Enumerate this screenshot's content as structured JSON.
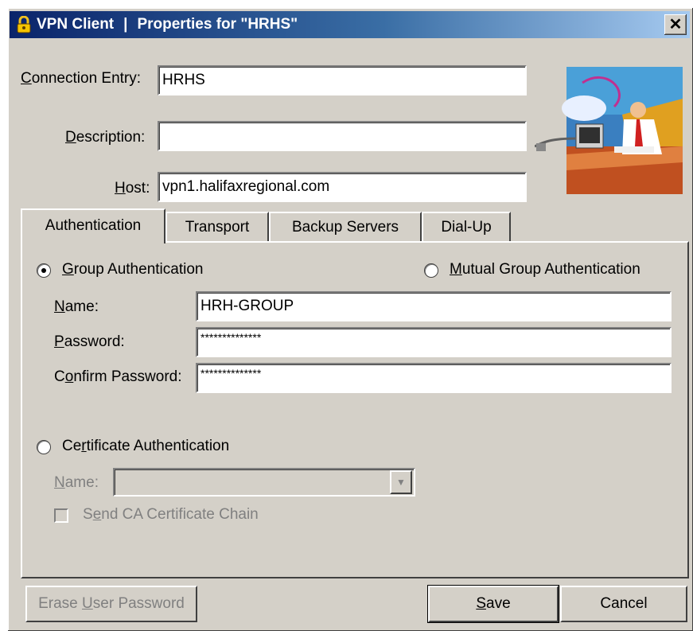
{
  "window": {
    "title_app": "VPN Client",
    "title_separator": "|",
    "title_text": "Properties for \"HRHS\"",
    "close_glyph": "✕"
  },
  "header": {
    "connection_entry": {
      "label_ul": "C",
      "label_rest": "onnection Entry:",
      "value": "HRHS"
    },
    "description": {
      "label_ul": "D",
      "label_rest": "escription:",
      "value": ""
    },
    "host": {
      "label_ul": "H",
      "label_rest": "ost:",
      "value": "vpn1.halifaxregional.com"
    }
  },
  "tabs": [
    {
      "label": "Authentication",
      "active": true
    },
    {
      "label": "Transport",
      "active": false
    },
    {
      "label": "Backup Servers",
      "active": false
    },
    {
      "label": "Dial-Up",
      "active": false
    }
  ],
  "auth": {
    "group_radio": {
      "label_ul": "G",
      "label_rest": "roup Authentication",
      "selected": true
    },
    "mutual_radio": {
      "label_ul": "M",
      "label_rest": "utual Group Authentication",
      "selected": false
    },
    "name": {
      "label_ul": "N",
      "label_rest": "ame:",
      "value": "HRH-GROUP"
    },
    "password": {
      "label_ul": "P",
      "label_rest": "assword:",
      "value": "**************"
    },
    "confirm_password": {
      "label_pre": "C",
      "label_ul": "o",
      "label_rest": "nfirm Password:",
      "value": "**************"
    },
    "cert_radio": {
      "label_pre": "Ce",
      "label_ul": "r",
      "label_rest": "tificate Authentication",
      "selected": false
    },
    "cert_name": {
      "label_ul": "N",
      "label_rest": "ame:",
      "value": ""
    },
    "send_ca": {
      "label_pre": "S",
      "label_ul": "e",
      "label_rest": "nd CA Certificate Chain",
      "checked": false
    }
  },
  "buttons": {
    "erase": {
      "label_pre": "Erase ",
      "label_ul": "U",
      "label_rest": "ser Password"
    },
    "save": {
      "label_ul": "S",
      "label_rest": "ave"
    },
    "cancel": {
      "label": "Cancel"
    }
  },
  "icons": {
    "title": "lock-icon",
    "close": "close-icon",
    "dropdown": "chevron-down-icon",
    "illustration": "network-user-illustration"
  },
  "colors": {
    "dialog_bg": "#d4d0c8",
    "title_start": "#0a246a",
    "title_end": "#a6caf0",
    "disabled_text": "#808080"
  }
}
